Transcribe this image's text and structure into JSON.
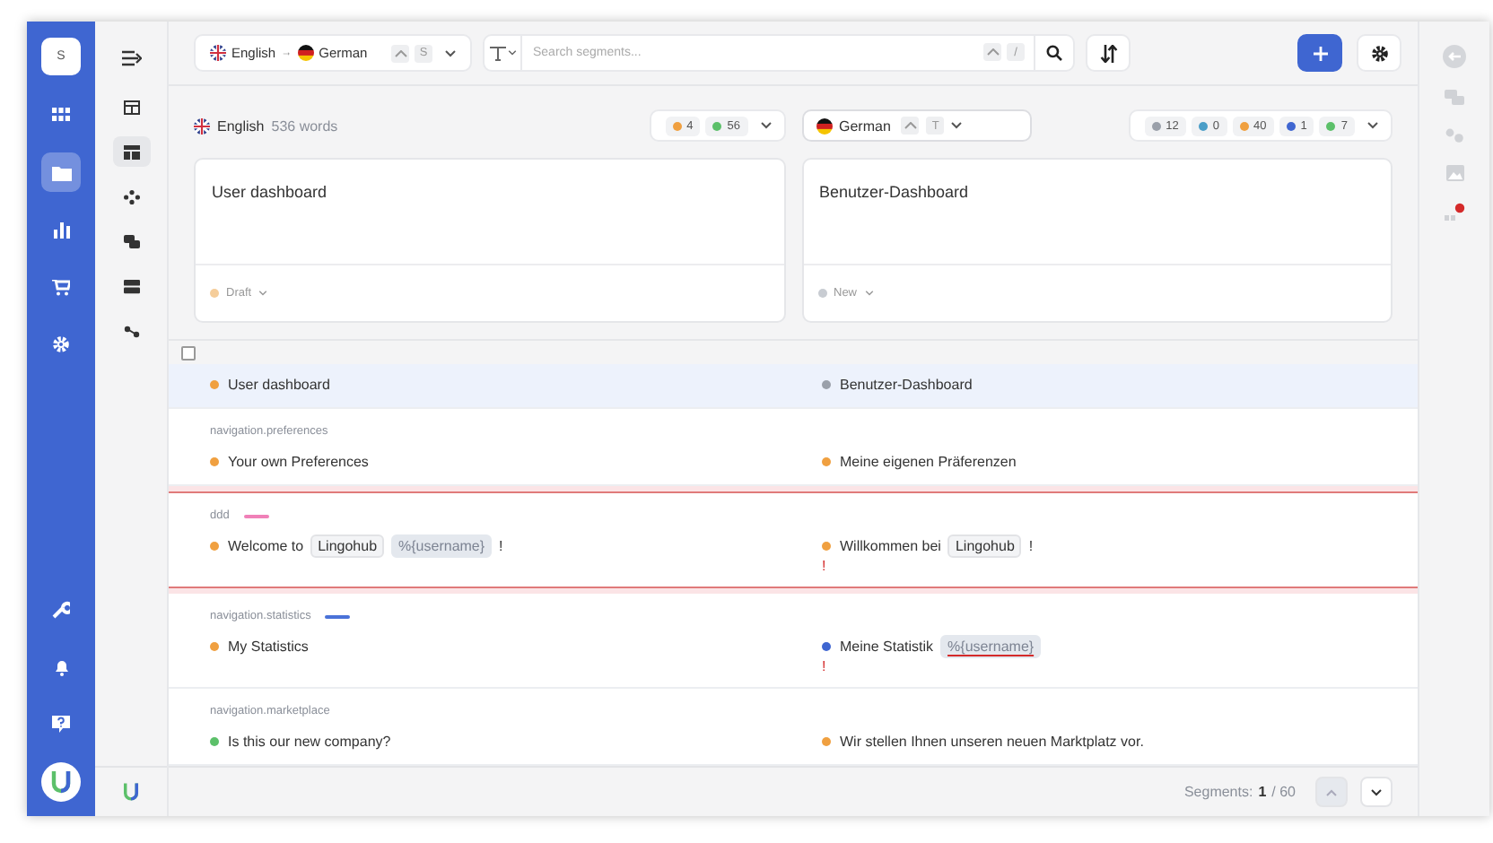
{
  "app_rail": {
    "avatar": "S",
    "items": [
      {
        "selected": false
      },
      {
        "selected": true
      },
      {
        "selected": false
      },
      {
        "selected": false
      },
      {
        "selected": false
      }
    ]
  },
  "nav_sidebar": {
    "items": [
      {
        "selected": false
      },
      {
        "selected": true
      },
      {
        "selected": false
      },
      {
        "selected": false
      },
      {
        "selected": false
      },
      {
        "selected": false
      }
    ]
  },
  "toolbar": {
    "language_pair": {
      "source": "English",
      "arrow": "→",
      "target": "German",
      "shortcut": "S"
    },
    "search": {
      "placeholder": "Search segments...",
      "shortcut": "/"
    }
  },
  "source_panel": {
    "language": "English",
    "word_count": "536 words",
    "stats": [
      {
        "count": "4",
        "color": "#f0a040"
      },
      {
        "count": "56",
        "color": "#5cc06a"
      }
    ],
    "text": "User dashboard",
    "status": {
      "label": "Draft",
      "color": "#f5cd9a"
    }
  },
  "target_panel": {
    "language": "German",
    "shortcut": "T",
    "stats": [
      {
        "count": "12",
        "color": "#9aa0aa"
      },
      {
        "count": "0",
        "color": "#4a9ec8"
      },
      {
        "count": "40",
        "color": "#f0a040"
      },
      {
        "count": "1",
        "color": "#3f66d1"
      },
      {
        "count": "7",
        "color": "#5cc06a"
      }
    ],
    "text": "Benutzer-Dashboard",
    "status": {
      "label": "New",
      "color": "#c8ccd2"
    }
  },
  "select_all": {
    "checked": false
  },
  "segments": [
    {
      "selected": true,
      "flagged": false,
      "source": {
        "color": "#f0a040",
        "parts": [
          {
            "kind": "text",
            "text": "User dashboard"
          }
        ]
      },
      "target": {
        "color": "#9aa0aa",
        "parts": [
          {
            "kind": "text",
            "text": "Benutzer-Dashboard"
          }
        ]
      }
    },
    {
      "key": "navigation.preferences",
      "selected": false,
      "flagged": false,
      "source": {
        "color": "#f0a040",
        "parts": [
          {
            "kind": "text",
            "text": "Your own Preferences"
          }
        ]
      },
      "target": {
        "color": "#f0a040",
        "parts": [
          {
            "kind": "text",
            "text": "Meine eigenen Präferenzen"
          }
        ]
      }
    },
    {
      "key": "ddd",
      "tag": {
        "color": "#f080b8"
      },
      "selected": false,
      "flagged": true,
      "source": {
        "color": "#f0a040",
        "parts": [
          {
            "kind": "text",
            "text": "Welcome to"
          },
          {
            "kind": "tag",
            "text": "Lingohub"
          },
          {
            "kind": "variable",
            "text": "%{username}",
            "invalid": false
          },
          {
            "kind": "text",
            "text": "!"
          }
        ]
      },
      "target": {
        "color": "#f0a040",
        "parts": [
          {
            "kind": "text",
            "text": "Willkommen bei"
          },
          {
            "kind": "tag",
            "text": "Lingohub"
          },
          {
            "kind": "text",
            "text": "!"
          }
        ]
      },
      "warning": "!"
    },
    {
      "key": "navigation.statistics",
      "tag": {
        "color": "#4a72d8"
      },
      "selected": false,
      "flagged": false,
      "source": {
        "color": "#f0a040",
        "parts": [
          {
            "kind": "text",
            "text": "My Statistics"
          }
        ]
      },
      "target": {
        "color": "#3f66d1",
        "parts": [
          {
            "kind": "text",
            "text": "Meine Statistik"
          },
          {
            "kind": "variable",
            "text": "%{username}",
            "invalid": true
          }
        ]
      },
      "warning": "!"
    },
    {
      "key": "navigation.marketplace",
      "selected": false,
      "flagged": false,
      "source": {
        "color": "#5cc06a",
        "parts": [
          {
            "kind": "text",
            "text": "Is this our new company?"
          }
        ]
      },
      "target": {
        "color": "#f0a040",
        "parts": [
          {
            "kind": "text",
            "text": "Wir stellen Ihnen unseren neuen Marktplatz vor."
          }
        ]
      }
    }
  ],
  "footer": {
    "label": "Segments:",
    "current": "1",
    "total": "/ 60"
  }
}
